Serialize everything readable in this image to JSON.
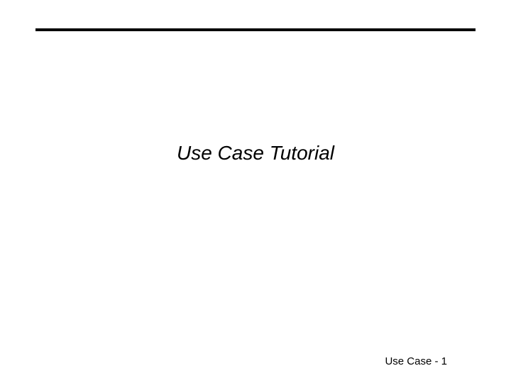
{
  "slide": {
    "title": "Use Case Tutorial",
    "footer": "Use Case - 1"
  }
}
